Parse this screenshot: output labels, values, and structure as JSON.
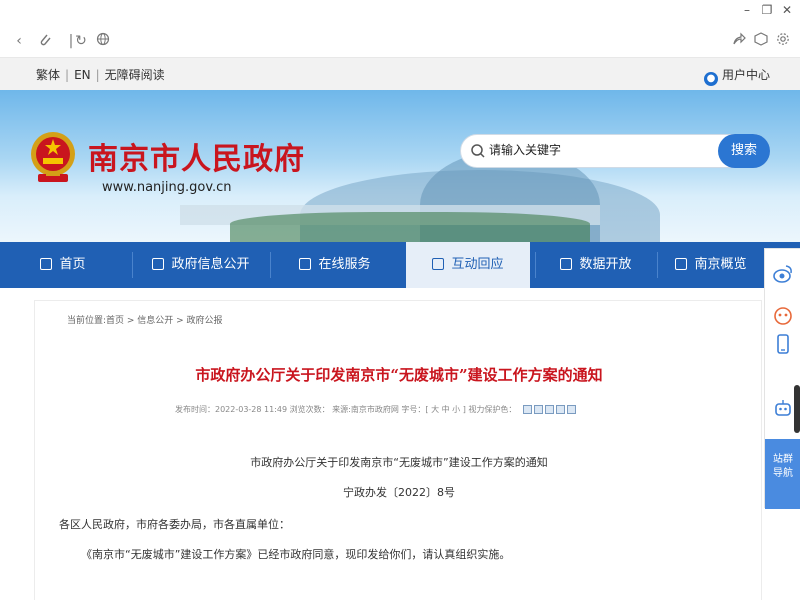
{
  "browser": {
    "controls": {
      "minimize": "–",
      "maximize": "❐",
      "close": "✕"
    }
  },
  "utility": {
    "links": [
      "繁体",
      "EN",
      "无障碍阅读"
    ],
    "user_center": "用户中心"
  },
  "header": {
    "site_title": "南京市人民政府",
    "site_url": "www.nanjing.gov.cn",
    "search_placeholder": "请输入关键字",
    "search_button": "搜索"
  },
  "nav": {
    "items": [
      {
        "label": "首页"
      },
      {
        "label": "政府信息公开"
      },
      {
        "label": "在线服务"
      },
      {
        "label": "互动回应"
      },
      {
        "label": "数据开放"
      },
      {
        "label": "南京概览"
      }
    ],
    "active_index": 3
  },
  "article": {
    "breadcrumb": "当前位置:首页 > 信息公开 > 政府公报",
    "title": "市政府办公厅关于印发南京市“无废城市”建设工作方案的通知",
    "meta": "发布时间：2022-03-28 11:49  浏览次数：  来源:南京市政府网  字号：[ 大 中 小 ]  视力保护色：",
    "doc_heading": "市政府办公厅关于印发南京市“无废城市”建设工作方案的通知",
    "doc_number": "宁政办发〔2022〕8号",
    "addressee": "各区人民政府，市府各委办局，市各直属单位：",
    "body": "《南京市“无废城市”建设工作方案》已经市政府同意，现印发给你们，请认真组织实施。"
  },
  "float_bar": {
    "nav_label_line1": "站群",
    "nav_label_line2": "导航"
  },
  "colors": {
    "brand_red": "#c9151e",
    "nav_blue": "#2060b4",
    "button_blue": "#2b76d2"
  }
}
